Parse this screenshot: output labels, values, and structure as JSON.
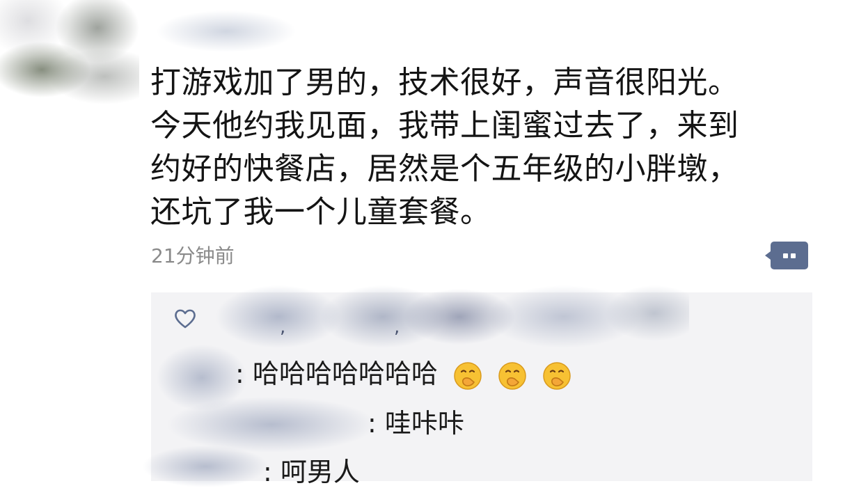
{
  "post": {
    "lines": [
      "打游戏加了男的，技术很好，声音很阳光。",
      "今天他约我见面，我带上闺蜜过去了，来到",
      "约好的快餐店，居然是个五年级的小胖墩，",
      "还坑了我一个儿童套餐。"
    ],
    "timestamp": "21分钟前"
  },
  "comments": [
    {
      "text": ": 哈哈哈哈哈哈哈",
      "emoji": "grinning-face-with-hand-over-mouth",
      "emoji_count": 3
    },
    {
      "text": ": 哇咔咔"
    },
    {
      "text": ": 呵男人"
    }
  ],
  "icons": {
    "like": "heart-outline-icon",
    "comment": "comment-bubble-icon"
  },
  "colors": {
    "accent": "#5c6d90",
    "panel": "#f3f3f5",
    "timestamp": "#8a8a8a"
  }
}
